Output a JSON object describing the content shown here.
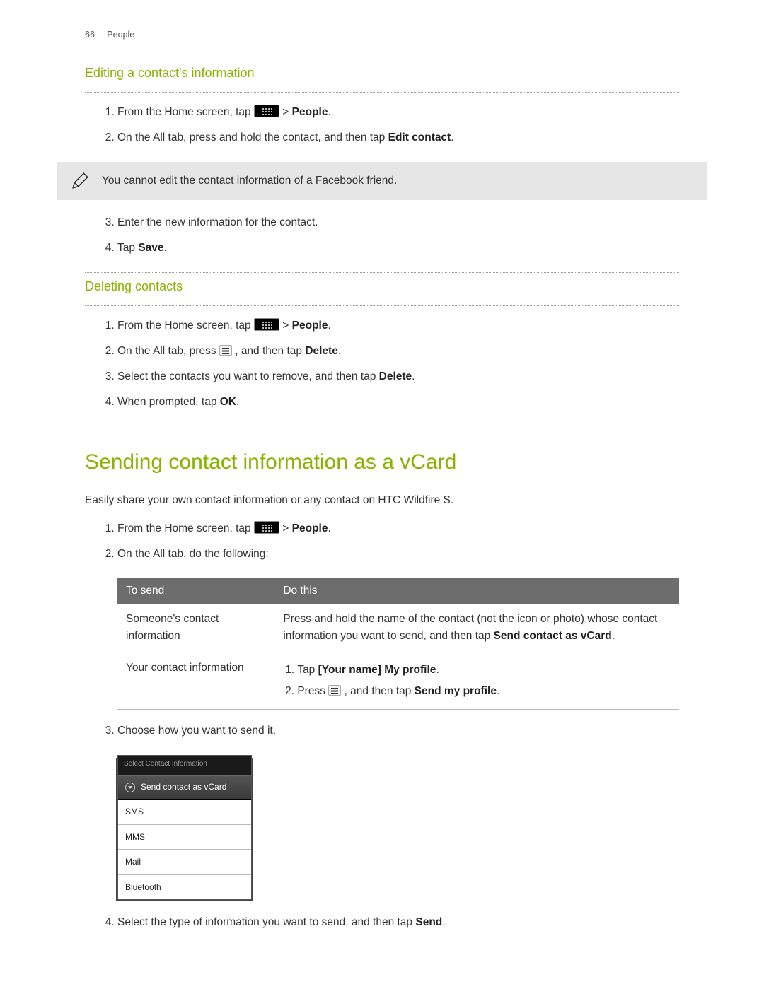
{
  "header": {
    "page_num": "66",
    "section": "People"
  },
  "editing": {
    "title": "Editing a contact's information",
    "step1_a": "From the Home screen, tap ",
    "step1_b": " > ",
    "step1_c": "People",
    "step1_d": ".",
    "step2_a": "On the All tab, press and hold the contact, and then tap ",
    "step2_b": "Edit contact",
    "step2_c": ".",
    "note": "You cannot edit the contact information of a Facebook friend.",
    "step3": "Enter the new information for the contact.",
    "step4_a": "Tap ",
    "step4_b": "Save",
    "step4_c": "."
  },
  "deleting": {
    "title": "Deleting contacts",
    "step1_a": "From the Home screen, tap ",
    "step1_b": " > ",
    "step1_c": "People",
    "step1_d": ".",
    "step2_a": "On the All tab, press ",
    "step2_b": ", and then tap ",
    "step2_c": "Delete",
    "step2_d": ".",
    "step3_a": "Select the contacts you want to remove, and then tap ",
    "step3_b": "Delete",
    "step3_c": ".",
    "step4_a": "When prompted, tap ",
    "step4_b": "OK",
    "step4_c": "."
  },
  "vcard": {
    "title": "Sending contact information as a vCard",
    "intro": "Easily share your own contact information or any contact on HTC Wildfire S.",
    "step1_a": "From the Home screen, tap ",
    "step1_b": " > ",
    "step1_c": "People",
    "step1_d": ".",
    "step2": "On the All tab, do the following:",
    "table": {
      "th1": "To send",
      "th2": "Do this",
      "r1c1": "Someone's contact information",
      "r1c2_a": "Press and hold the name of the contact (not the icon or photo) whose contact information you want to send, and then tap ",
      "r1c2_b": "Send contact as vCard",
      "r1c2_c": ".",
      "r2c1": "Your contact information",
      "r2_s1_a": "Tap ",
      "r2_s1_b": "[Your name] My profile",
      "r2_s1_c": ".",
      "r2_s2_a": "Press ",
      "r2_s2_b": ", and then tap ",
      "r2_s2_c": "Send my profile",
      "r2_s2_d": "."
    },
    "step3": "Choose how you want to send it.",
    "dialog": {
      "title": "Select Contact Information",
      "head": "Send contact as vCard",
      "items": [
        "SMS",
        "MMS",
        "Mail",
        "Bluetooth"
      ]
    },
    "step4_a": "Select the type of information you want to send, and then tap ",
    "step4_b": "Send",
    "step4_c": "."
  }
}
